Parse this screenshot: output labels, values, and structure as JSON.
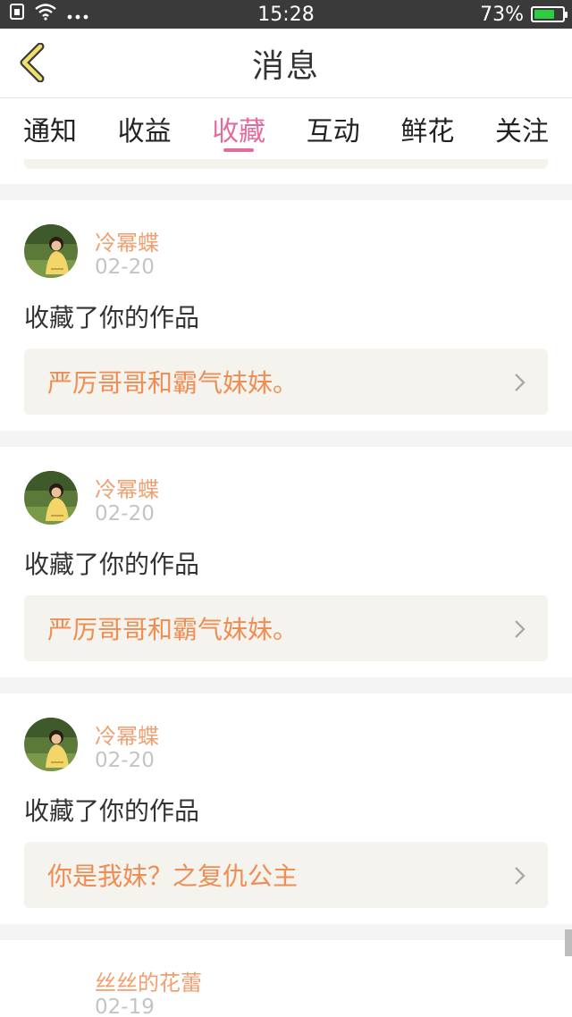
{
  "status_bar": {
    "time": "15:28",
    "battery": "73%",
    "battery_level": 0.73,
    "icons": [
      "sim-icon",
      "wifi-icon",
      "more-dots-icon",
      "battery-charging-icon"
    ]
  },
  "header": {
    "title": "消息",
    "back_icon": "chevron-left-icon"
  },
  "tabs": [
    {
      "label": "通知",
      "active": false
    },
    {
      "label": "收益",
      "active": false
    },
    {
      "label": "收藏",
      "active": true
    },
    {
      "label": "互动",
      "active": false
    },
    {
      "label": "鲜花",
      "active": false
    },
    {
      "label": "关注",
      "active": false
    }
  ],
  "messages": [
    {
      "username": "冷幂蝶",
      "date": "02-20",
      "action": "收藏了你的作品",
      "work_title": "严厉哥哥和霸气妹妹。"
    },
    {
      "username": "冷幂蝶",
      "date": "02-20",
      "action": "收藏了你的作品",
      "work_title": "严厉哥哥和霸气妹妹。"
    },
    {
      "username": "冷幂蝶",
      "date": "02-20",
      "action": "收藏了你的作品",
      "work_title": "你是我妹？之复仇公主"
    },
    {
      "username": "丝丝的花蕾",
      "date": "02-19"
    }
  ],
  "colors": {
    "accent_pink": "#e46b9e",
    "username_orange": "#f0a070",
    "work_title_orange": "#ef8d53",
    "status_bar_bg": "#3a3a3a"
  }
}
